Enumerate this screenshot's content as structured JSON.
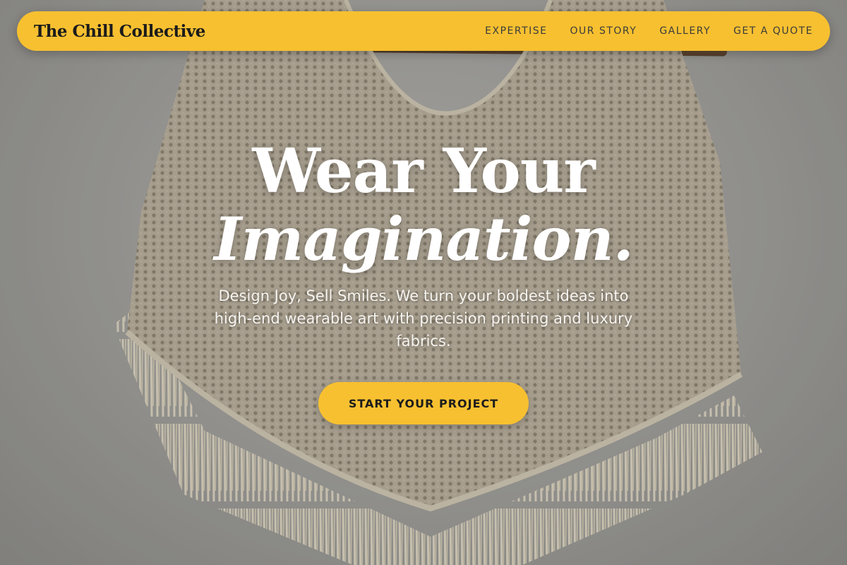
{
  "colors": {
    "accent": "#F7C030",
    "text_light": "#FFFFFF",
    "text_dark": "#1B1B1B"
  },
  "nav": {
    "brand": "The Chill Collective",
    "links": [
      {
        "label": "EXPERTISE"
      },
      {
        "label": "OUR STORY"
      },
      {
        "label": "GALLERY"
      },
      {
        "label": "GET A QUOTE"
      }
    ]
  },
  "hero": {
    "headline_line1": "Wear Your",
    "headline_line2": "Imagination.",
    "subtext": "Design Joy, Sell Smiles. We turn your boldest ideas into high-end wearable art with precision printing and luxury fabrics.",
    "cta_label": "START YOUR PROJECT",
    "background_image": "cream knitted fringe poncho on wooden hanger against grey wall"
  }
}
